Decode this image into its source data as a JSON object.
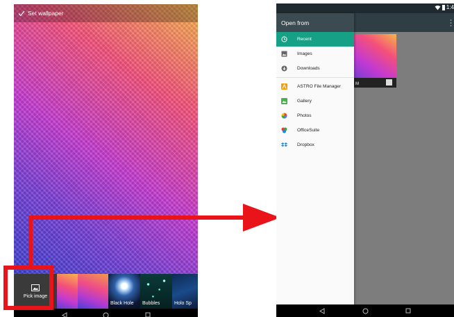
{
  "left": {
    "topbar": {
      "set_wallpaper_label": "Set wallpaper"
    },
    "thumbnails": [
      {
        "label": "Pick image",
        "icon": "image-icon"
      },
      {
        "label": ""
      },
      {
        "label": ""
      },
      {
        "label": "Black Hole"
      },
      {
        "label": "Bubbles"
      },
      {
        "label": "Holo Sp"
      }
    ],
    "navbar": [
      "back-icon",
      "home-icon",
      "recents-icon"
    ]
  },
  "right": {
    "status": {
      "time": "1:4"
    },
    "drawer": {
      "title": "Open from",
      "items": [
        {
          "label": "Recent",
          "icon": "clock-icon",
          "active": true
        },
        {
          "label": "Images",
          "icon": "image-icon"
        },
        {
          "label": "Downloads",
          "icon": "download-icon"
        },
        {
          "label": "ASTRO File Manager",
          "icon": "astro-icon"
        },
        {
          "label": "Gallery",
          "icon": "gallery-icon"
        },
        {
          "label": "Photos",
          "icon": "photos-icon"
        },
        {
          "label": "OfficeSuite",
          "icon": "officesuite-icon"
        },
        {
          "label": "Dropbox",
          "icon": "dropbox-icon"
        }
      ]
    },
    "preview_letter": "M"
  },
  "colors": {
    "accent": "#16a085",
    "highlight_red": "#e8141a",
    "drawer_header": "#3c4b51"
  }
}
